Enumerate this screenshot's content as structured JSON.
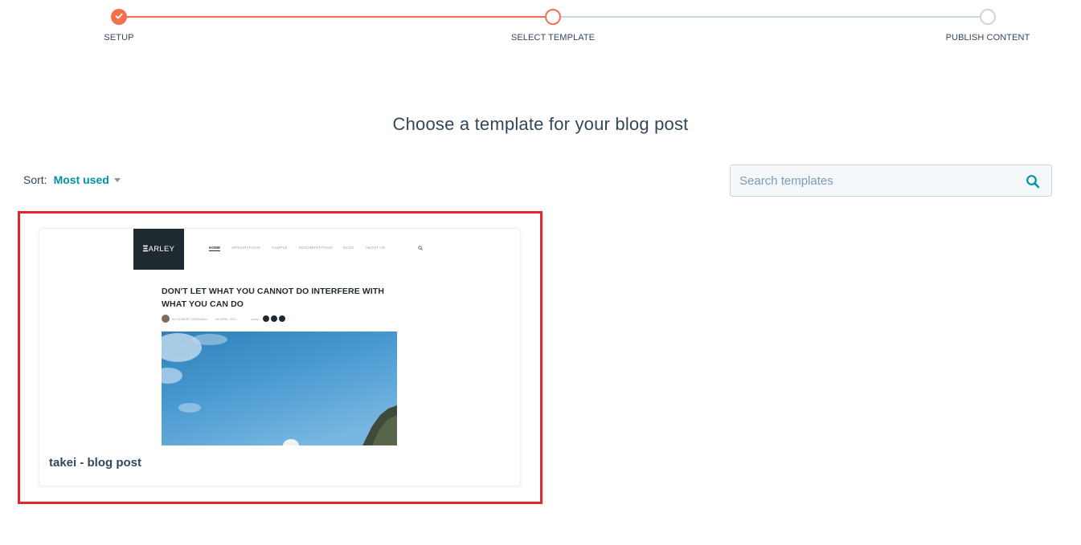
{
  "stepper": {
    "steps": [
      {
        "label": "SETUP",
        "state": "complete"
      },
      {
        "label": "SELECT TEMPLATE",
        "state": "active"
      },
      {
        "label": "PUBLISH CONTENT",
        "state": "pending"
      }
    ],
    "accent_color": "#f2704e",
    "pending_color": "#cbd6e2"
  },
  "heading": {
    "title": "Choose a template for your blog post"
  },
  "sort": {
    "label": "Sort:",
    "value": "Most used"
  },
  "search": {
    "placeholder": "Search templates",
    "value": ""
  },
  "templates": [
    {
      "name": "takei - blog post",
      "selected": true,
      "preview": {
        "logo_text": "ARLEY",
        "nav_items": [
          "HOME",
          "INTEGRATIONS",
          "SAMPLE",
          "DOCUMENTATION",
          "BLOG",
          "ABOUT US"
        ],
        "post_title": "DON'T LET WHAT YOU CANNOT DO INTERFERE WITH WHAT YOU CAN DO",
        "author": "BY ROBERT FREEMAN",
        "date": "26 APRIL 2021",
        "share_label": "share"
      }
    }
  ],
  "colors": {
    "text": "#33475b",
    "link": "#0091ae",
    "highlight_border": "#e5252d"
  }
}
